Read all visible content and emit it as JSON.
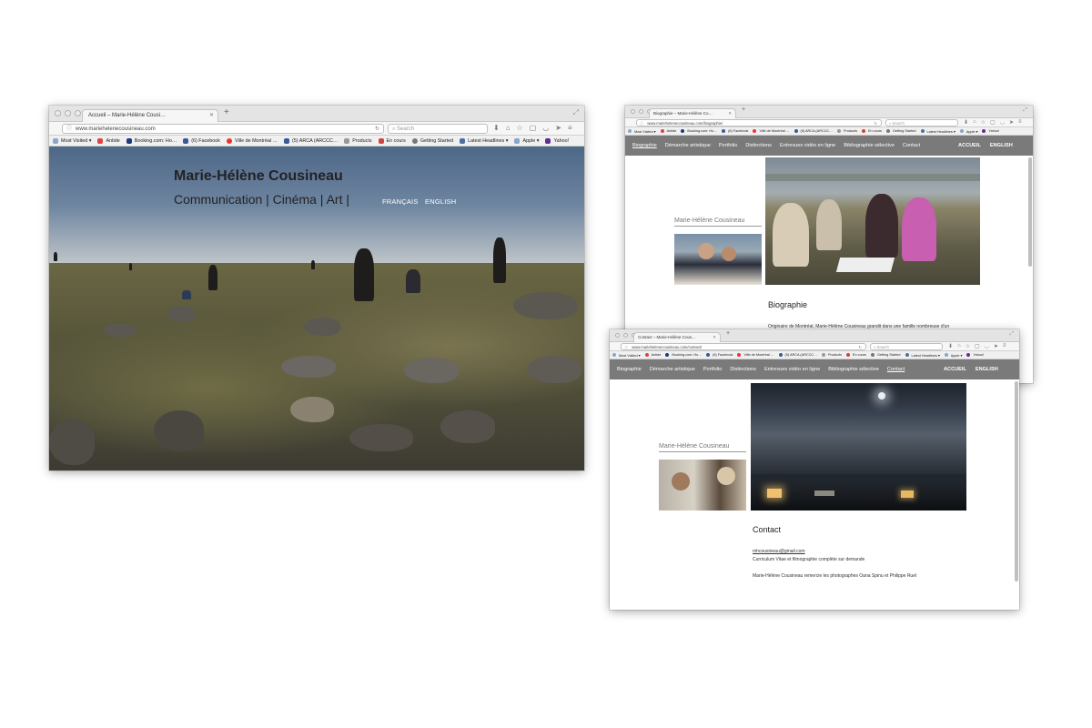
{
  "window1": {
    "tab_title": "Accueil – Marie-Hélène Cousi…",
    "url": "www.mariehelenecousineau.com",
    "search_placeholder": "Search",
    "bookmarks": [
      "Most Visited ▾",
      "Antide",
      "Booking.com: Ho…",
      "(6) Facebook",
      "Ville de Montréal …",
      "(5) ARCA (ARCCC…",
      "Products",
      "En cours",
      "Getting Started",
      "Latest Headlines ▾",
      "Apple ▾",
      "Yahoo!"
    ],
    "site_title": "Marie-Hélène Cousineau",
    "site_subtitle": "Communication | Cinéma | Art |",
    "lang_fr": "FRANÇAIS",
    "lang_en": "ENGLISH"
  },
  "window2": {
    "tab_title": "Biographie – Marie-Hélène Co…",
    "url": "www.mariehelenecousineau.com/biographie/",
    "search_placeholder": "Search",
    "bookmarks": [
      "Most Visited ▾",
      "Antide",
      "Booking.com: Ho…",
      "(6) Facebook",
      "Ville de Montréal …",
      "(5) ARCA (ARCCC…",
      "Products",
      "En cours",
      "Getting Started",
      "Latest Headlines ▾",
      "Apple ▾",
      "Yahoo!"
    ],
    "nav": [
      "Biographie",
      "Démarche artistique",
      "Portfolio",
      "Distinctions",
      "Entrevues vidéo en ligne",
      "Bibliographie sélective",
      "Contact"
    ],
    "nav_right": [
      "ACCUEIL",
      "ENGLISH"
    ],
    "sidebar_name": "Marie-Hélène Cousineau",
    "heading": "Biographie",
    "body_text": "Originaire de Montréal, Marie-Hélène Cousineau grandit dans une famille nombreuse d'un"
  },
  "window3": {
    "tab_title": "Contact – Marie-Hélène Cous…",
    "url": "www.mariehelenecousineau.com/contact/",
    "search_placeholder": "Search",
    "bookmarks": [
      "Most Visited ▾",
      "Antide",
      "Booking.com: Ho…",
      "(6) Facebook",
      "Ville de Montréal …",
      "(5) ARCA (ARCCC…",
      "Products",
      "En cours",
      "Getting Started",
      "Latest Headlines ▾",
      "Apple ▾",
      "Yahoo!"
    ],
    "nav": [
      "Biographie",
      "Démarche artistique",
      "Portfolio",
      "Distinctions",
      "Entrevues vidéo en ligne",
      "Bibliographie sélective",
      "Contact"
    ],
    "nav_right": [
      "ACCUEIL",
      "ENGLISH"
    ],
    "sidebar_name": "Marie-Hélène Cousineau",
    "heading": "Contact",
    "email": "mhcousineau@gmail.com",
    "cv_note": "Curriculum Vitae et filmographie complète sur demande",
    "thanks": "Marie-Hélène Cousineau remercie les photographes Oana Spinu et Philippe Ruel"
  },
  "colors": {
    "site_nav_bg": "#7a7a7a",
    "chrome_bg": "#e4e4e4"
  }
}
